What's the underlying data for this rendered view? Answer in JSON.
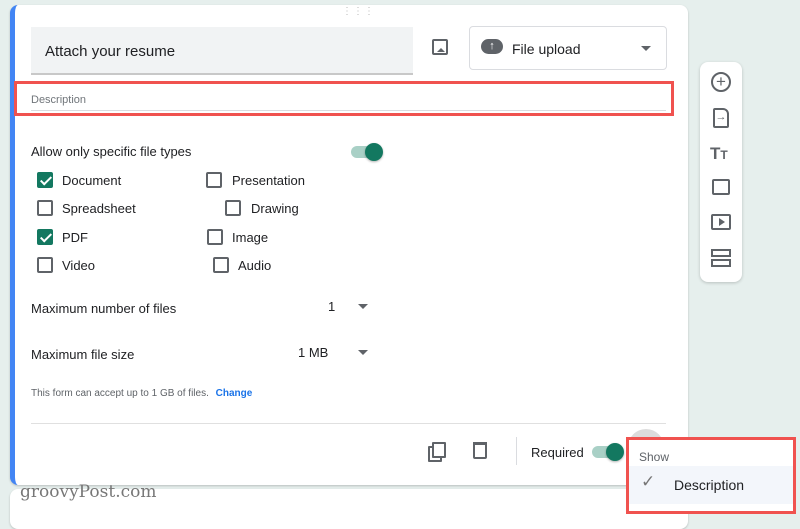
{
  "question": {
    "title": "Attach your resume",
    "type": "File upload",
    "description_placeholder": "Description"
  },
  "file_types": {
    "label": "Allow only specific file types",
    "enabled": true,
    "options": [
      {
        "label": "Document",
        "checked": true
      },
      {
        "label": "Presentation",
        "checked": false
      },
      {
        "label": "Spreadsheet",
        "checked": false
      },
      {
        "label": "Drawing",
        "checked": false
      },
      {
        "label": "PDF",
        "checked": true
      },
      {
        "label": "Image",
        "checked": false
      },
      {
        "label": "Video",
        "checked": false
      },
      {
        "label": "Audio",
        "checked": false
      }
    ]
  },
  "max_files": {
    "label": "Maximum number of files",
    "value": "1"
  },
  "max_size": {
    "label": "Maximum file size",
    "value": "1 MB"
  },
  "capacity": {
    "text": "This form can accept up to 1 GB of files.",
    "link": "Change"
  },
  "footer": {
    "required_label": "Required",
    "required": true
  },
  "menu": {
    "header": "Show",
    "item": "Description",
    "item_checked": true
  },
  "watermark": "groovyPost.com",
  "colors": {
    "accent": "#137860",
    "highlight": "#f0524f",
    "card_border": "#4285f4"
  }
}
